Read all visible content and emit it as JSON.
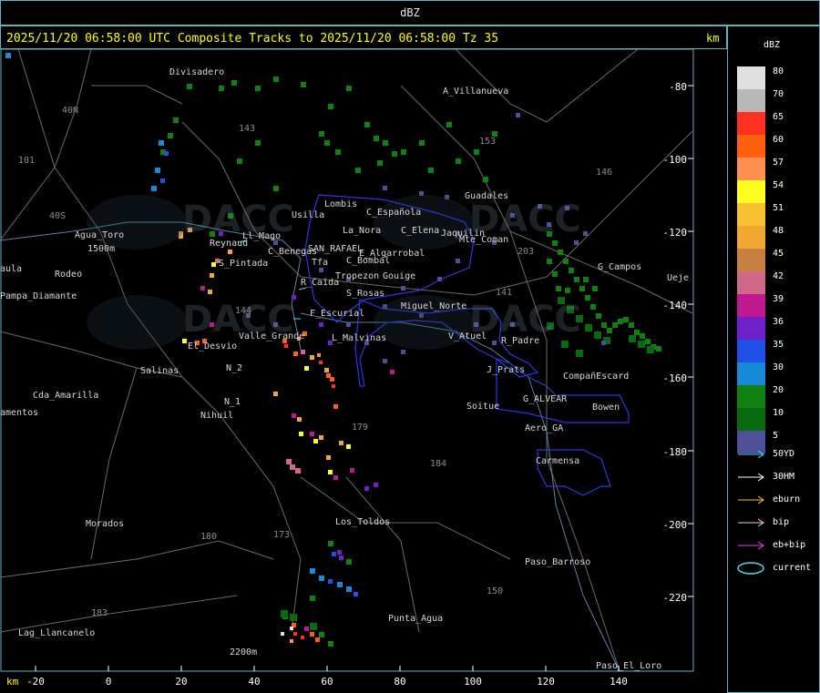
{
  "title": "dBZ",
  "header": "2025/11/20 06:58:00 UTC Composite Tracks to 2025/11/20 06:58:00 Tz 35",
  "km_label": "km",
  "legend": {
    "title": "dBZ",
    "levels": [
      {
        "label": "80",
        "color": "#e0e0e0"
      },
      {
        "label": "70",
        "color": "#b8b8b8"
      },
      {
        "label": "65",
        "color": "#ff3020"
      },
      {
        "label": "60",
        "color": "#ff6010"
      },
      {
        "label": "57",
        "color": "#ff9050"
      },
      {
        "label": "54",
        "color": "#ffff20"
      },
      {
        "label": "51",
        "color": "#f8c030"
      },
      {
        "label": "48",
        "color": "#f0a830"
      },
      {
        "label": "45",
        "color": "#c88040"
      },
      {
        "label": "42",
        "color": "#d06888"
      },
      {
        "label": "39",
        "color": "#c01890"
      },
      {
        "label": "36",
        "color": "#7020c8"
      },
      {
        "label": "35",
        "color": "#2050e8"
      },
      {
        "label": "30",
        "color": "#1888d8"
      },
      {
        "label": "20",
        "color": "#108010"
      },
      {
        "label": "10",
        "color": "#0a6a10"
      },
      {
        "label": "5",
        "color": "#505098"
      }
    ],
    "tracks": [
      {
        "label": "50YD",
        "color": "#40e0f0"
      },
      {
        "label": "30HM",
        "color": "#ffffff"
      },
      {
        "label": "eburn",
        "color": "#ffc040"
      },
      {
        "label": "bip",
        "color": "#ffc0c0"
      },
      {
        "label": "eb+bip",
        "color": "#e040e0"
      },
      {
        "label": "current",
        "color": "#40e0f0"
      }
    ]
  },
  "axes": {
    "x_unit": "km",
    "x_ticks": [
      "-20",
      "0",
      "20",
      "40",
      "60",
      "80",
      "100",
      "120",
      "140"
    ],
    "y_ticks": [
      "-80",
      "-100",
      "-120",
      "-140",
      "-160",
      "-180",
      "-200",
      "-220"
    ]
  },
  "places": [
    {
      "name": "Divisadero"
    },
    {
      "name": "A_Villanueva"
    },
    {
      "name": "Guadales"
    },
    {
      "name": "Agua_Toro"
    },
    {
      "name": "Rodeo"
    },
    {
      "name": "aula"
    },
    {
      "name": "Pampa_Diamante"
    },
    {
      "name": "El_Desvio"
    },
    {
      "name": "Salinas"
    },
    {
      "name": "Cda_Amarilla"
    },
    {
      "name": "amentos"
    },
    {
      "name": "Nihuil"
    },
    {
      "name": "N_2"
    },
    {
      "name": "N_1"
    },
    {
      "name": "Valle_Grande"
    },
    {
      "name": "L_Malvinas"
    },
    {
      "name": "F_Escurial"
    },
    {
      "name": "R_Caida"
    },
    {
      "name": "S_Rosas"
    },
    {
      "name": "Miguel_Norte"
    },
    {
      "name": "V_Atuel"
    },
    {
      "name": "R_Padre"
    },
    {
      "name": "J_Prats"
    },
    {
      "name": "CompañEscard"
    },
    {
      "name": "G_ALVEAR"
    },
    {
      "name": "Bowen"
    },
    {
      "name": "Soitue"
    },
    {
      "name": "Aero_GA"
    },
    {
      "name": "Carmensa"
    },
    {
      "name": "Morados"
    },
    {
      "name": "Los_Toldos"
    },
    {
      "name": "Paso_Barroso"
    },
    {
      "name": "Punta_Agua"
    },
    {
      "name": "Lag_Llancanelo"
    },
    {
      "name": "Paso_El_Loro"
    },
    {
      "name": "Ueje"
    },
    {
      "name": "G_Campos"
    },
    {
      "name": "Reynaud"
    },
    {
      "name": "S_Pintada"
    },
    {
      "name": "Usilla"
    },
    {
      "name": "La_Nora"
    },
    {
      "name": "C_Española"
    },
    {
      "name": "C_Elena"
    },
    {
      "name": "Jaquilin"
    },
    {
      "name": "Mte_Coman"
    },
    {
      "name": "SAN_RAFAEL"
    },
    {
      "name": "E_Algarrobal"
    },
    {
      "name": "C_Bombal"
    },
    {
      "name": "C_Benegas"
    },
    {
      "name": "Tropezon"
    },
    {
      "name": "Gouige"
    },
    {
      "name": "Lombis"
    },
    {
      "name": "Tfa"
    },
    {
      "name": "Ll_Mago"
    },
    {
      "name": "2200m"
    },
    {
      "name": "1500m"
    }
  ],
  "route_numbers": [
    "143",
    "153",
    "146",
    "141",
    "144",
    "203",
    "101",
    "179",
    "184",
    "180",
    "183",
    "150",
    "173",
    "40N",
    "40S"
  ]
}
